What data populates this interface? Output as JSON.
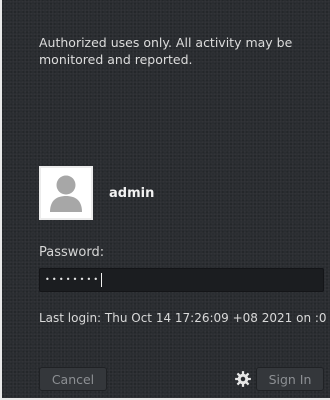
{
  "banner": {
    "text": "Authorized uses only. All activity may be monitored and reported."
  },
  "user": {
    "avatar_icon": "user-silhouette-icon",
    "name": "admin"
  },
  "password": {
    "label": "Password:",
    "value": "••••••••"
  },
  "session": {
    "last_login": "Last login: Thu Oct 14 17:26:09 +08 2021 on :0"
  },
  "actions": {
    "cancel_label": "Cancel",
    "settings_icon": "gear-icon",
    "sign_in_label": "Sign In"
  },
  "colors": {
    "background": "#2a2d31",
    "field_background": "#1b1d20",
    "text": "#e6e6e6",
    "disabled_button_text": "#8c8f93"
  }
}
